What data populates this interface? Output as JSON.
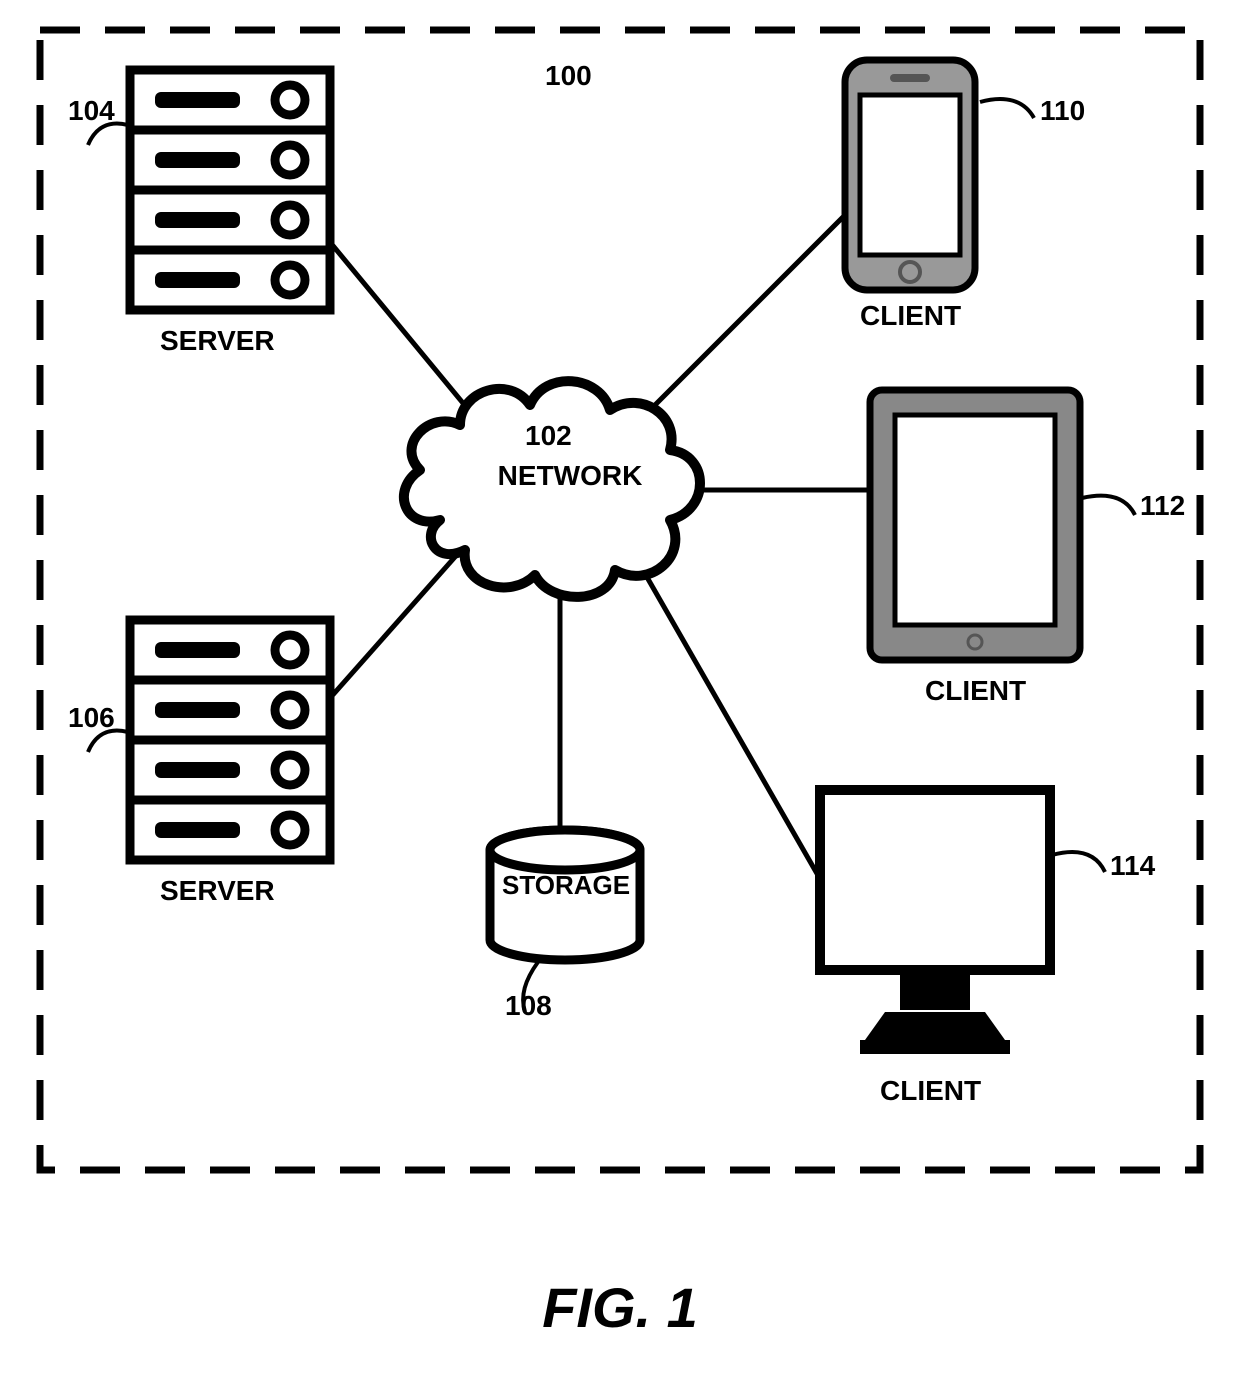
{
  "figure": {
    "caption": "FIG. 1",
    "system_ref": "100"
  },
  "network": {
    "ref": "102",
    "label": "NETWORK"
  },
  "storage": {
    "ref": "108",
    "label": "STORAGE"
  },
  "servers": [
    {
      "ref": "104",
      "label": "SERVER"
    },
    {
      "ref": "106",
      "label": "SERVER"
    }
  ],
  "clients": [
    {
      "ref": "110",
      "label": "CLIENT",
      "device": "phone"
    },
    {
      "ref": "112",
      "label": "CLIENT",
      "device": "tablet"
    },
    {
      "ref": "114",
      "label": "CLIENT",
      "device": "desktop"
    }
  ]
}
